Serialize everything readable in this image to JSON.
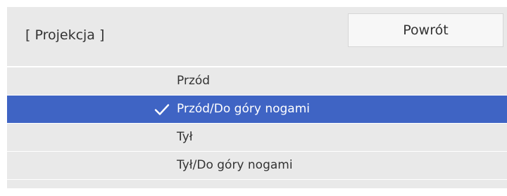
{
  "header": {
    "title": "[ Projekcja ]",
    "back_label": "Powrót"
  },
  "options": [
    {
      "label": "Przód",
      "selected": false
    },
    {
      "label": "Przód/Do góry nogami",
      "selected": true
    },
    {
      "label": "Tył",
      "selected": false
    },
    {
      "label": "Tył/Do góry nogami",
      "selected": false
    }
  ],
  "colors": {
    "panel_background": "#e9e9e9",
    "selected_background": "#3f64c4",
    "selected_text": "#ffffff",
    "text": "#333333"
  },
  "icons": {
    "selected_marker": "check-icon"
  }
}
